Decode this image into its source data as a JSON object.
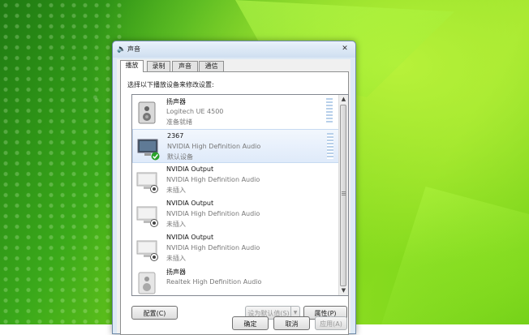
{
  "window": {
    "title": "声音",
    "close_glyph": "✕"
  },
  "tabs": [
    {
      "label": "播放",
      "active": true
    },
    {
      "label": "录制"
    },
    {
      "label": "声音"
    },
    {
      "label": "通信"
    }
  ],
  "instruction": "选择以下播放设备来修改设置:",
  "devices": [
    {
      "name": "扬声器",
      "description": "Logitech UE 4500",
      "status": "准备就绪",
      "icon": "speaker-icon",
      "badge": ""
    },
    {
      "name": "2367",
      "description": "NVIDIA High Definition Audio",
      "status": "默认设备",
      "icon": "monitor-icon",
      "badge": "default-check-icon",
      "selected": true
    },
    {
      "name": "NVIDIA Output",
      "description": "NVIDIA High Definition Audio",
      "status": "未插入",
      "icon": "monitor-icon",
      "badge": "unplugged-icon"
    },
    {
      "name": "NVIDIA Output",
      "description": "NVIDIA High Definition Audio",
      "status": "未插入",
      "icon": "monitor-icon",
      "badge": "unplugged-icon"
    },
    {
      "name": "NVIDIA Output",
      "description": "NVIDIA High Definition Audio",
      "status": "未插入",
      "icon": "monitor-icon",
      "badge": "unplugged-icon"
    },
    {
      "name": "扬声器",
      "description": "Realtek High Definition Audio",
      "status": "",
      "icon": "speaker-icon",
      "badge": "unplugged-icon"
    }
  ],
  "buttons": {
    "configure": "配置(C)",
    "set_default": "设为默认值(S)",
    "properties": "属性(P)",
    "ok": "确定",
    "cancel": "取消",
    "apply": "应用(A)"
  },
  "colors": {
    "accent": "#c7daf1",
    "check": "#2aa12a"
  }
}
